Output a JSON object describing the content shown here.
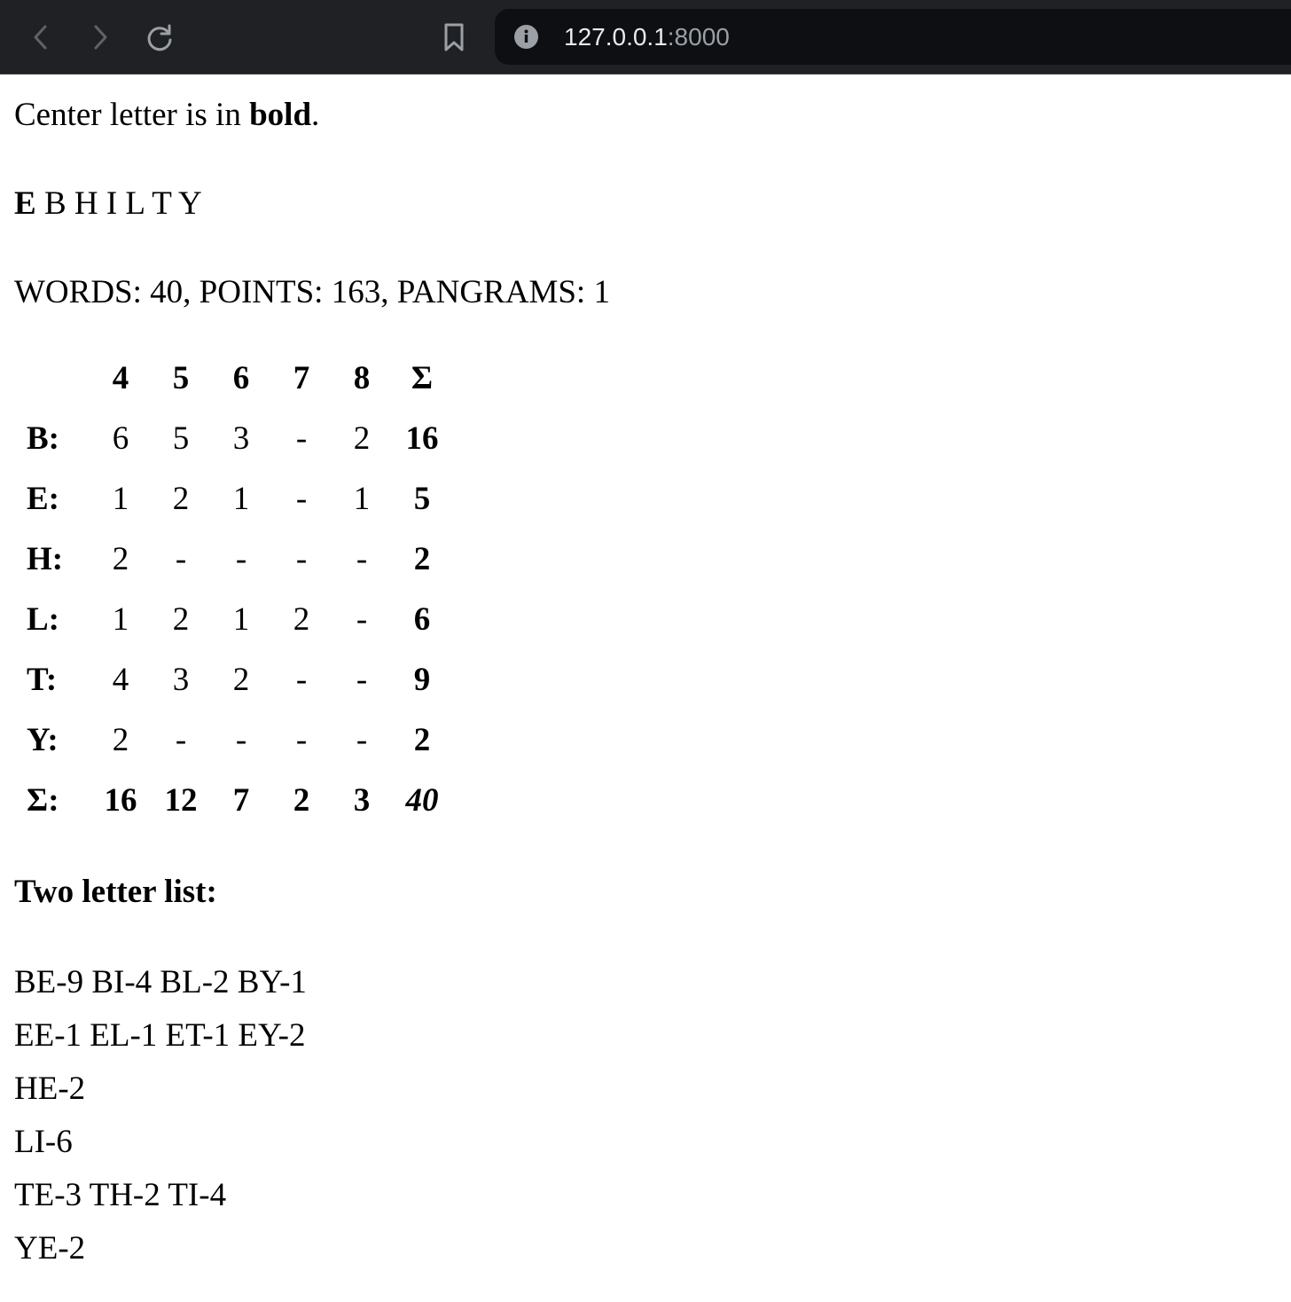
{
  "browser": {
    "url_host": "127.0.0.1",
    "url_port": ":8000",
    "colors": {
      "toolbar": "#202124",
      "omnibox": "#0e0f12",
      "icon": "#9aa0a6"
    }
  },
  "page": {
    "intro": {
      "prefix": "Center letter is in ",
      "bold": "bold",
      "suffix": "."
    },
    "center_letter": "E",
    "other_letters": "B H I L T Y",
    "stats": "WORDS: 40, POINTS: 163, PANGRAMS: 1",
    "grid": {
      "header": [
        "",
        "4",
        "5",
        "6",
        "7",
        "8",
        "Σ"
      ],
      "rows": [
        {
          "label": "B:",
          "cells": [
            "6",
            "5",
            "3",
            "-",
            "2"
          ],
          "sum": "16"
        },
        {
          "label": "E:",
          "cells": [
            "1",
            "2",
            "1",
            "-",
            "1"
          ],
          "sum": "5"
        },
        {
          "label": "H:",
          "cells": [
            "2",
            "-",
            "-",
            "-",
            "-"
          ],
          "sum": "2"
        },
        {
          "label": "L:",
          "cells": [
            "1",
            "2",
            "1",
            "2",
            "-"
          ],
          "sum": "6"
        },
        {
          "label": "T:",
          "cells": [
            "4",
            "3",
            "2",
            "-",
            "-"
          ],
          "sum": "9"
        },
        {
          "label": "Y:",
          "cells": [
            "2",
            "-",
            "-",
            "-",
            "-"
          ],
          "sum": "2"
        }
      ],
      "totals": {
        "label": "Σ:",
        "cells": [
          "16",
          "12",
          "7",
          "2",
          "3"
        ],
        "sum": "40"
      }
    },
    "two_letter_heading": "Two letter list:",
    "two_letter_lines": [
      "BE-9 BI-4 BL-2 BY-1",
      "EE-1 EL-1 ET-1 EY-2",
      "HE-2",
      "LI-6",
      "TE-3 TH-2 TI-4",
      "YE-2"
    ]
  }
}
